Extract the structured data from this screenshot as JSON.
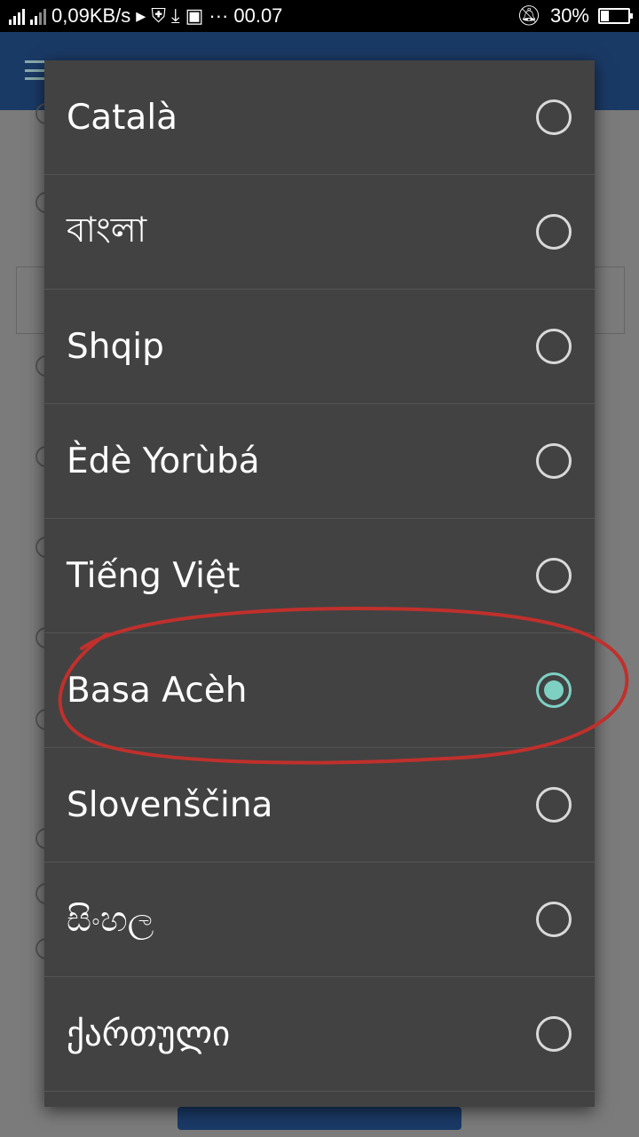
{
  "status_bar": {
    "network_speed": "0,09KB/s",
    "time": "00.07",
    "battery_percent": "30%",
    "battery_level": 0.3,
    "more_indicator": "···"
  },
  "language_dialog": {
    "options": [
      {
        "label": "Català",
        "selected": false
      },
      {
        "label": "বাংলা",
        "selected": false
      },
      {
        "label": "Shqip",
        "selected": false
      },
      {
        "label": "Èdè Yorùbá",
        "selected": false
      },
      {
        "label": "Tiếng Việt",
        "selected": false
      },
      {
        "label": "Basa Acèh",
        "selected": true
      },
      {
        "label": "Slovenščina",
        "selected": false
      },
      {
        "label": "සිංහල",
        "selected": false
      },
      {
        "label": "ქართული",
        "selected": false
      }
    ]
  },
  "colors": {
    "dialog_background": "#424242",
    "radio_accent": "#7ed0c3",
    "annotation": "#c0302c",
    "app_bar": "#1a3a66"
  }
}
